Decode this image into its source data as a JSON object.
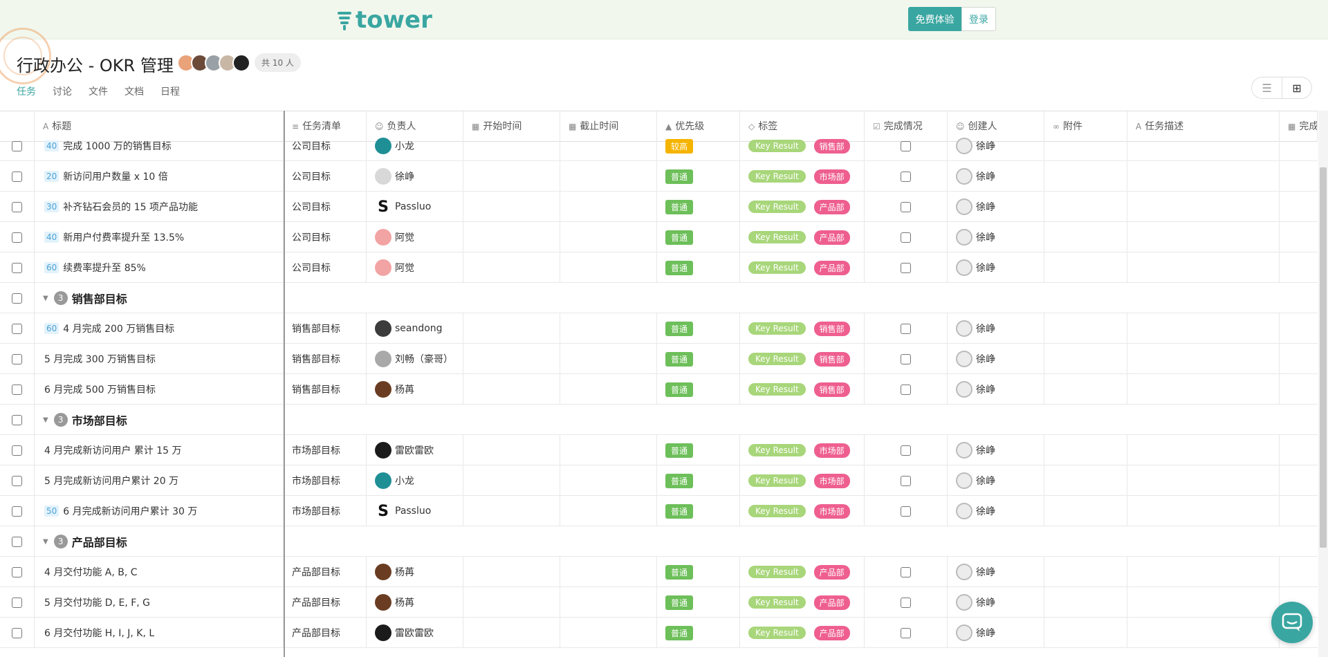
{
  "brand": {
    "name": "tower",
    "color": "#3aa6a1"
  },
  "header": {
    "trial_label": "免费体验",
    "login_label": "登录"
  },
  "project": {
    "title": "行政办公 - OKR 管理",
    "member_count": "共 10 人"
  },
  "tabs": [
    {
      "label": "任务",
      "active": true
    },
    {
      "label": "讨论",
      "active": false
    },
    {
      "label": "文件",
      "active": false
    },
    {
      "label": "文档",
      "active": false
    },
    {
      "label": "日程",
      "active": false
    }
  ],
  "columns": {
    "title": "标题",
    "list": "任务清单",
    "assignee": "负责人",
    "start": "开始时间",
    "due": "截止时间",
    "priority": "优先级",
    "tags": "标签",
    "done": "完成情况",
    "creator": "创建人",
    "attach": "附件",
    "desc": "任务描述",
    "done_time": "完成"
  },
  "colors": {
    "priority_high": "#f5b400",
    "priority_normal": "#6dbf5a",
    "tag_kr": "#a8d67a",
    "tag_dept": "#ee5f8f"
  },
  "rows": [
    {
      "kind": "task",
      "progress": "40",
      "title": "完成 1000 万的销售目标",
      "list": "公司目标",
      "assignee": "小龙",
      "av": "teal",
      "priority": "较高",
      "pri_level": "high",
      "tag1": "Key Result",
      "tag2": "销售部",
      "creator": "徐峥"
    },
    {
      "kind": "task",
      "progress": "20",
      "title": "新访问用户数量 x 10 倍",
      "list": "公司目标",
      "assignee": "徐峥",
      "av": "gray",
      "priority": "普通",
      "pri_level": "normal",
      "tag1": "Key Result",
      "tag2": "市场部",
      "creator": "徐峥"
    },
    {
      "kind": "task",
      "progress": "30",
      "title": "补齐钻石会员的 15 项产品功能",
      "list": "公司目标",
      "assignee": "Passluo",
      "av": "s",
      "priority": "普通",
      "pri_level": "normal",
      "tag1": "Key Result",
      "tag2": "产品部",
      "creator": "徐峥"
    },
    {
      "kind": "task",
      "progress": "40",
      "title": "新用户付费率提升至 13.5%",
      "list": "公司目标",
      "assignee": "阿觉",
      "av": "pink",
      "priority": "普通",
      "pri_level": "normal",
      "tag1": "Key Result",
      "tag2": "产品部",
      "creator": "徐峥"
    },
    {
      "kind": "task",
      "progress": "60",
      "title": "续费率提升至 85%",
      "list": "公司目标",
      "assignee": "阿觉",
      "av": "pink",
      "priority": "普通",
      "pri_level": "normal",
      "tag1": "Key Result",
      "tag2": "产品部",
      "creator": "徐峥"
    },
    {
      "kind": "group",
      "count": "3",
      "title": "销售部目标"
    },
    {
      "kind": "task",
      "progress": "60",
      "title": "4 月完成 200 万销售目标",
      "list": "销售部目标",
      "assignee": "seandong",
      "av": "dark",
      "priority": "普通",
      "pri_level": "normal",
      "tag1": "Key Result",
      "tag2": "销售部",
      "creator": "徐峥"
    },
    {
      "kind": "task",
      "progress": "",
      "title": "5 月完成 300 万销售目标",
      "list": "销售部目标",
      "assignee": "刘畅（豪哥）",
      "av": "grayb",
      "priority": "普通",
      "pri_level": "normal",
      "tag1": "Key Result",
      "tag2": "销售部",
      "creator": "徐峥"
    },
    {
      "kind": "task",
      "progress": "",
      "title": "6 月完成 500 万销售目标",
      "list": "销售部目标",
      "assignee": "杨苒",
      "av": "brown",
      "priority": "普通",
      "pri_level": "normal",
      "tag1": "Key Result",
      "tag2": "销售部",
      "creator": "徐峥"
    },
    {
      "kind": "group",
      "count": "3",
      "title": "市场部目标"
    },
    {
      "kind": "task",
      "progress": "",
      "title": "4 月完成新访问用户 累计 15 万",
      "list": "市场部目标",
      "assignee": "雷欧雷欧",
      "av": "black",
      "priority": "普通",
      "pri_level": "normal",
      "tag1": "Key Result",
      "tag2": "市场部",
      "creator": "徐峥"
    },
    {
      "kind": "task",
      "progress": "",
      "title": "5 月完成新访问用户累计 20 万",
      "list": "市场部目标",
      "assignee": "小龙",
      "av": "teal",
      "priority": "普通",
      "pri_level": "normal",
      "tag1": "Key Result",
      "tag2": "市场部",
      "creator": "徐峥"
    },
    {
      "kind": "task",
      "progress": "50",
      "title": "6 月完成新访问用户累计 30 万",
      "list": "市场部目标",
      "assignee": "Passluo",
      "av": "s",
      "priority": "普通",
      "pri_level": "normal",
      "tag1": "Key Result",
      "tag2": "市场部",
      "creator": "徐峥"
    },
    {
      "kind": "group",
      "count": "3",
      "title": "产品部目标"
    },
    {
      "kind": "task",
      "progress": "",
      "title": "4 月交付功能 A, B, C",
      "list": "产品部目标",
      "assignee": "杨苒",
      "av": "brown",
      "priority": "普通",
      "pri_level": "normal",
      "tag1": "Key Result",
      "tag2": "产品部",
      "creator": "徐峥"
    },
    {
      "kind": "task",
      "progress": "",
      "title": "5 月交付功能 D, E, F, G",
      "list": "产品部目标",
      "assignee": "杨苒",
      "av": "brown",
      "priority": "普通",
      "pri_level": "normal",
      "tag1": "Key Result",
      "tag2": "产品部",
      "creator": "徐峥"
    },
    {
      "kind": "task",
      "progress": "",
      "title": "6 月交付功能 H, I, J, K, L",
      "list": "产品部目标",
      "assignee": "雷欧雷欧",
      "av": "black",
      "priority": "普通",
      "pri_level": "normal",
      "tag1": "Key Result",
      "tag2": "产品部",
      "creator": "徐峥"
    }
  ]
}
